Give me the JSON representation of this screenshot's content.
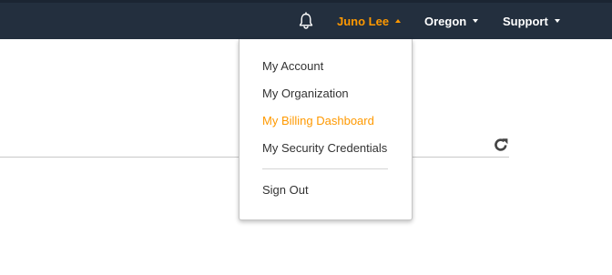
{
  "topnav": {
    "bell_icon": "bell-icon",
    "user_label": "Juno Lee",
    "region_label": "Oregon",
    "support_label": "Support",
    "accent_color": "#ff9900",
    "bar_color": "#232f3e"
  },
  "account_menu": {
    "items": [
      {
        "label": "My Account"
      },
      {
        "label": "My Organization"
      },
      {
        "label": "My Billing Dashboard",
        "state": "highlighted"
      },
      {
        "label": "My Security Credentials"
      }
    ],
    "signout_label": "Sign Out"
  },
  "content": {
    "refresh_icon": "refresh-icon"
  }
}
